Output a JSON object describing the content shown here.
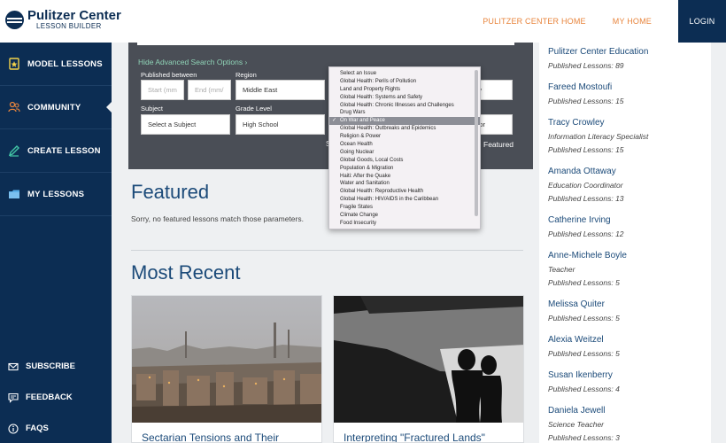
{
  "brand": {
    "title": "Pulitzer Center",
    "subtitle": "LESSON BUILDER"
  },
  "topnav": {
    "home": "PULITZER CENTER HOME",
    "my_home": "MY HOME",
    "login": "LOGIN"
  },
  "sidebar": {
    "items": [
      {
        "label": "MODEL LESSONS"
      },
      {
        "label": "COMMUNITY"
      },
      {
        "label": "CREATE LESSON"
      },
      {
        "label": "MY LESSONS"
      }
    ],
    "bottom": [
      {
        "label": "SUBSCRIBE"
      },
      {
        "label": "FEEDBACK"
      },
      {
        "label": "FAQS"
      }
    ]
  },
  "search": {
    "adv_link": "Hide Advanced Search Options ›",
    "published_label": "Published between",
    "start_placeholder": "Start (mm",
    "end_placeholder": "End (mm/",
    "region_label": "Region",
    "region_value": "Middle East",
    "subject_label": "Subject",
    "subject_value": "Select a Subject",
    "grade_label": "Grade Level",
    "grade_value": "High School",
    "right_frag1": "y",
    "right_frag2": "or",
    "s_frag": "S",
    "featured_label": "Featured"
  },
  "issue_dropdown": {
    "options": [
      "Select an Issue",
      "Global Health: Perils of Pollution",
      "Land and Property Rights",
      "Global Health: Systems and Safety",
      "Global Health: Chronic Illnesses and Challenges",
      "Drug Wars",
      "On War and Peace",
      "Global Health: Outbreaks and Epidemics",
      "Religion & Power",
      "Ocean Health",
      "Going Nuclear",
      "Global Goods, Local Costs",
      "Population & Migration",
      "Haiti: After the Quake",
      "Water and Sanitation",
      "Global Health: Reproductive Health",
      "Global Health: HIV/AIDS in the Caribbean",
      "Fragile States",
      "Climate Change",
      "Food Insecurity"
    ],
    "selected": "On War and Peace"
  },
  "featured": {
    "title": "Featured",
    "empty": "Sorry, no featured lessons match those parameters."
  },
  "recent": {
    "title": "Most Recent",
    "cards": [
      {
        "title": "Sectarian Tensions and Their"
      },
      {
        "title": "Interpreting \"Fractured Lands\""
      }
    ]
  },
  "community": [
    {
      "name": "Pulitzer Center Education",
      "role": "",
      "count": "Published Lessons: 89"
    },
    {
      "name": "Fareed Mostoufi",
      "role": "",
      "count": "Published Lessons: 15"
    },
    {
      "name": "Tracy Crowley",
      "role": "Information Literacy Specialist",
      "count": "Published Lessons: 15"
    },
    {
      "name": "Amanda Ottaway",
      "role": "Education Coordinator",
      "count": "Published Lessons: 13"
    },
    {
      "name": "Catherine Irving",
      "role": "",
      "count": "Published Lessons: 12"
    },
    {
      "name": "Anne-Michele Boyle",
      "role": "Teacher",
      "count": "Published Lessons: 5"
    },
    {
      "name": "Melissa Quiter",
      "role": "",
      "count": "Published Lessons: 5"
    },
    {
      "name": "Alexia Weitzel",
      "role": "",
      "count": "Published Lessons: 5"
    },
    {
      "name": "Susan Ikenberry",
      "role": "",
      "count": "Published Lessons: 4"
    },
    {
      "name": "Daniela Jewell",
      "role": "Science Teacher",
      "count": "Published Lessons: 3"
    }
  ],
  "colors": {
    "navy": "#0c2d53",
    "accent_orange": "#e8853d",
    "link_blue": "#1b4a79",
    "adv_green": "#8fd3b6"
  }
}
